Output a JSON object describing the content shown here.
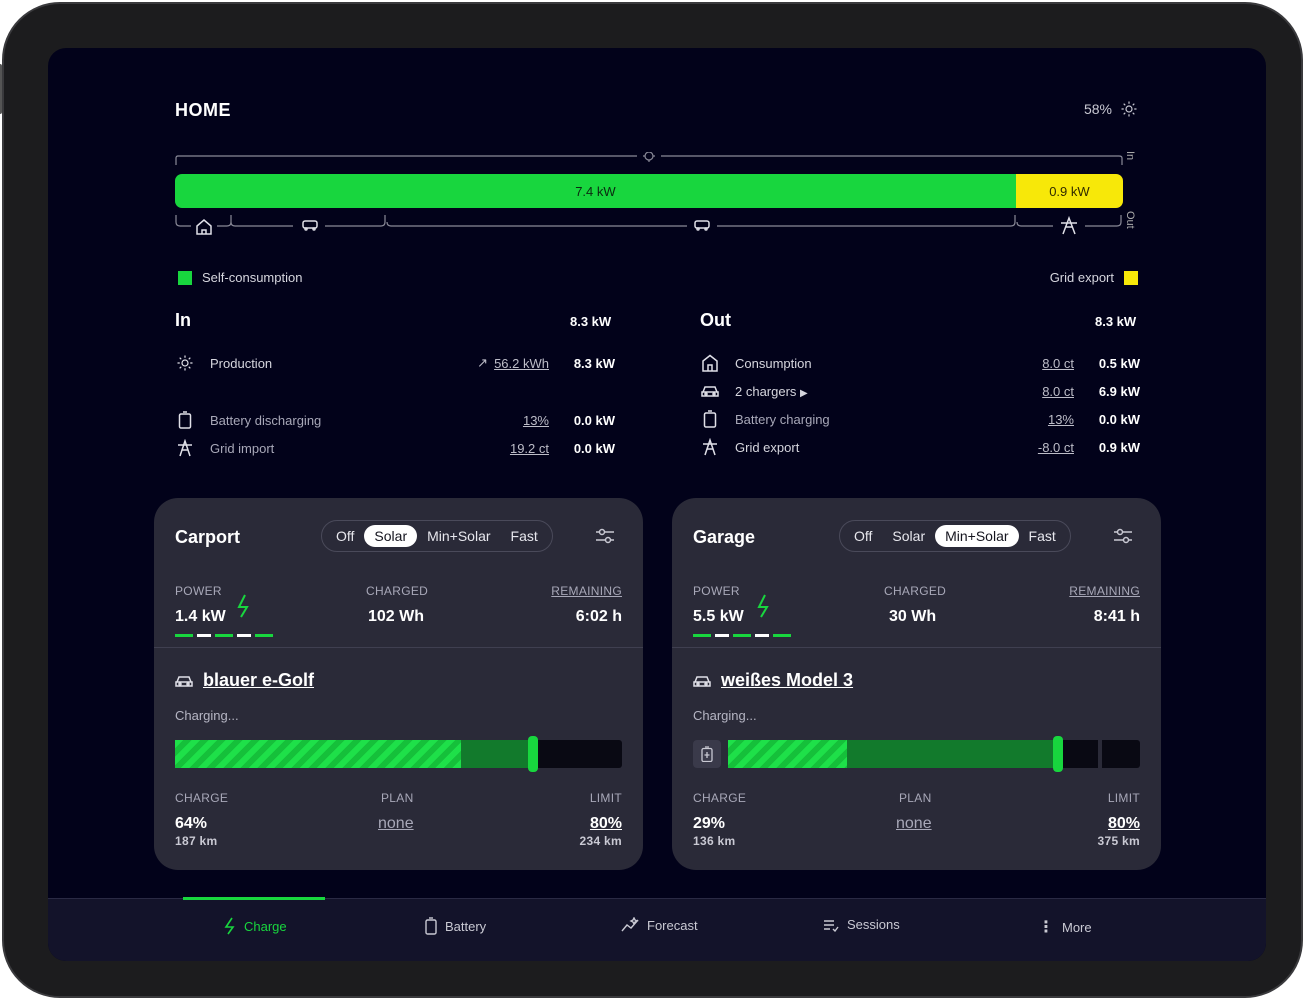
{
  "header": {
    "title": "HOME",
    "solar_percent": "58%"
  },
  "energy_flow": {
    "self_consumption_value": "7.4 kW",
    "grid_export_value": "0.9 kW",
    "self_consumption_fraction": 0.887,
    "grid_export_fraction": 0.113,
    "in_label": "In",
    "out_label": "Out"
  },
  "legend": {
    "self_consumption": "Self-consumption",
    "grid_export": "Grid export"
  },
  "colors": {
    "green": "#18d63e",
    "yellow": "#f7e809",
    "background": "#02021a",
    "card": "#2a2a38"
  },
  "in_section": {
    "title": "In",
    "total": "8.3 kW",
    "rows": [
      {
        "icon": "sun-icon",
        "label": "Production",
        "detail": "56.2 kWh",
        "value": "8.3 kW"
      },
      {
        "icon": "battery-icon",
        "label": "Battery discharging",
        "detail": "13%",
        "value": "0.0 kW"
      },
      {
        "icon": "power-tower-icon",
        "label": "Grid import",
        "detail": "19.2 ct",
        "value": "0.0 kW"
      }
    ]
  },
  "out_section": {
    "title": "Out",
    "total": "8.3 kW",
    "rows": [
      {
        "icon": "home-icon",
        "label": "Consumption",
        "detail": "8.0 ct",
        "value": "0.5 kW"
      },
      {
        "icon": "car-icon",
        "label": "2 chargers",
        "detail": "8.0 ct",
        "value": "6.9 kW"
      },
      {
        "icon": "battery-icon",
        "label": "Battery charging",
        "detail": "13%",
        "value": "0.0 kW"
      },
      {
        "icon": "power-tower-icon",
        "label": "Grid export",
        "detail": "-8.0 ct",
        "value": "0.9 kW"
      }
    ]
  },
  "loadpoints": [
    {
      "title": "Carport",
      "modes": [
        "Off",
        "Solar",
        "Min+Solar",
        "Fast"
      ],
      "selected_mode": "Solar",
      "power_label": "POWER",
      "power": "1.4 kW",
      "charged_label": "CHARGED",
      "charged": "102 Wh",
      "remaining_label": "REMAINING",
      "remaining": "6:02 h",
      "vehicle": "blauer e-Golf",
      "status": "Charging...",
      "charge_fraction": 0.64,
      "limit_fraction": 0.8,
      "charge_label": "CHARGE",
      "charge": "64%",
      "charge_range": "187 km",
      "plan_label": "PLAN",
      "plan": "none",
      "limit_label": "LIMIT",
      "limit": "80%",
      "limit_range": "234 km"
    },
    {
      "title": "Garage",
      "modes": [
        "Off",
        "Solar",
        "Min+Solar",
        "Fast"
      ],
      "selected_mode": "Min+Solar",
      "power_label": "POWER",
      "power": "5.5 kW",
      "charged_label": "CHARGED",
      "charged": "30 Wh",
      "remaining_label": "REMAINING",
      "remaining": "8:41 h",
      "vehicle": "weißes Model 3",
      "status": "Charging...",
      "charge_fraction": 0.29,
      "limit_fraction": 0.8,
      "charge_label": "CHARGE",
      "charge": "29%",
      "charge_range": "136 km",
      "plan_label": "PLAN",
      "plan": "none",
      "limit_label": "LIMIT",
      "limit": "80%",
      "limit_range": "375 km"
    }
  ],
  "nav": [
    {
      "icon": "bolt-icon",
      "label": "Charge",
      "active": true
    },
    {
      "icon": "battery-icon",
      "label": "Battery",
      "active": false
    },
    {
      "icon": "forecast-icon",
      "label": "Forecast",
      "active": false
    },
    {
      "icon": "sessions-icon",
      "label": "Sessions",
      "active": false
    },
    {
      "icon": "more-icon",
      "label": "More",
      "active": false
    }
  ]
}
